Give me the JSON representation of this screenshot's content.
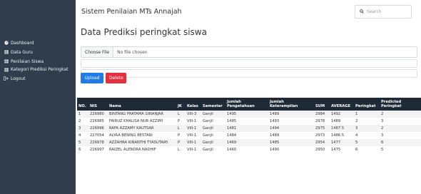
{
  "app": {
    "title": "Sistem Penilaian MTs Annajah"
  },
  "search": {
    "placeholder": "Search"
  },
  "sidebar": {
    "items": [
      {
        "icon": "dashboard-icon",
        "label": "Dashboard"
      },
      {
        "icon": "table-icon",
        "label": "Data Guru"
      },
      {
        "icon": "table-icon",
        "label": "Penilaian Siswa"
      },
      {
        "icon": "table-icon",
        "label": "Kategori Prediksi Peringkat"
      },
      {
        "icon": "logout-icon",
        "label": "Logout"
      }
    ]
  },
  "main": {
    "title": "Data Prediksi peringkat siswa",
    "file": {
      "button": "Choose File",
      "status": "No file chosen"
    },
    "upload_label": "Upload",
    "delete_label": "Delete"
  },
  "table": {
    "headers": [
      "NO.",
      "NIS",
      "Nama",
      "JK",
      "Kelas",
      "Semester",
      "Jumlah Pengetahuan",
      "Jumlah Keterampilan",
      "SUM",
      "AVERAGE",
      "Peringkat",
      "Predicted Peringkat"
    ],
    "rows": [
      [
        "1",
        "226980",
        "BINTANG PRATAMA GINANJAR",
        "L",
        "VIII-3",
        "Ganjil",
        "1495",
        "1489",
        "2984",
        "1492",
        "1",
        "2"
      ],
      [
        "2",
        "226985",
        "FAIRUZ KHALISA NUR AZZIMI",
        "P",
        "VIII-1",
        "Ganjil",
        "1485",
        "1493",
        "2978",
        "1489",
        "2",
        "3"
      ],
      [
        "3",
        "226996",
        "RAFA AZZAMY KAUTSAR",
        "L",
        "VIII-1",
        "Ganjil",
        "1481",
        "1494",
        "2975",
        "1487.5",
        "3",
        "2"
      ],
      [
        "4",
        "227054",
        "ALYAA BENING BESTARI",
        "P",
        "VIII-1",
        "Ganjil",
        "1484",
        "1489",
        "2973",
        "1486.5",
        "4",
        "3"
      ],
      [
        "5",
        "226978",
        "AZZAHRA KINANTHI TYASUTAMI",
        "P",
        "VIII-1",
        "Ganjil",
        "1469",
        "1485",
        "2954",
        "1477",
        "5",
        "6"
      ],
      [
        "6",
        "226997",
        "RAIZEL ALENDRA NADHIF",
        "L",
        "VIII-1",
        "Ganjil",
        "1460",
        "1490",
        "2950",
        "1475",
        "6",
        "5"
      ]
    ]
  }
}
